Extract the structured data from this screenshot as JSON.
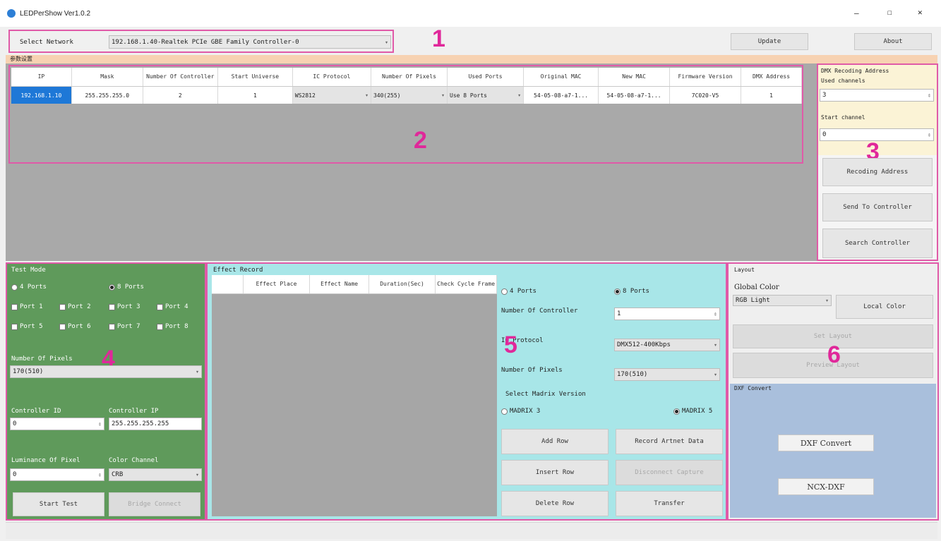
{
  "window": {
    "title": "LEDPerShow Ver1.0.2",
    "controls": {
      "minimize": "—",
      "maximize": "☐",
      "close": "✕"
    }
  },
  "annotations": [
    "1",
    "2",
    "3",
    "4",
    "5",
    "6"
  ],
  "network": {
    "label": "Select Network",
    "value": "192.168.1.40-Realtek PCIe GBE Family Controller-0",
    "update": "Update",
    "about": "About"
  },
  "section_title": "参数设置",
  "controller_table": {
    "headers": [
      "IP",
      "Mask",
      "Number Of Controller",
      "Start Universe",
      "IC Protocol",
      "Number Of Pixels",
      "Used Ports",
      "Original MAC",
      "New MAC",
      "Firmware Version",
      "DMX Address"
    ],
    "rows": [
      [
        "192.168.1.10",
        "255.255.255.0",
        "2",
        "1",
        "WS2812",
        "340(255)",
        "Use 8 Ports",
        "54-05-08-a7-1...",
        "54-05-08-a7-1...",
        "7C020-V5",
        "1"
      ]
    ]
  },
  "dmx_panel": {
    "title": "DMX Recoding Address",
    "used_channels_label": "Used channels",
    "used_channels_value": "3",
    "start_channel_label": "Start channel",
    "start_channel_value": "0",
    "recoding_button": "Recoding Address",
    "send_button": "Send To Controller",
    "search_button": "Search Controller"
  },
  "test_mode": {
    "title": "Test Mode",
    "ports4": "4 Ports",
    "ports8": "8 Ports",
    "port_checks": [
      "Port 1",
      "Port 2",
      "Port 3",
      "Port 4",
      "Port 5",
      "Port 6",
      "Port 7",
      "Port 8"
    ],
    "pixels_label": "Number Of Pixels",
    "pixels_value": "170(510)",
    "controller_id_label": "Controller ID",
    "controller_id_value": "0",
    "controller_ip_label": "Controller IP",
    "controller_ip_value": "255.255.255.255",
    "luminance_label": "Luminance Of Pixel",
    "luminance_value": "0",
    "color_channel_label": "Color Channel",
    "color_channel_value": "CRB",
    "start_test": "Start Test",
    "bridge_connect": "Bridge Connect"
  },
  "effect_record": {
    "title": "Effect Record",
    "headers": [
      "",
      "Effect Place",
      "Effect Name",
      "Duration(Sec)",
      "Check Cycle Frame"
    ],
    "ports4": "4 Ports",
    "ports8": "8 Ports",
    "controller_count_label": "Number Of Controller",
    "controller_count_value": "1",
    "ic_protocol_label": "IC Protocol",
    "ic_protocol_value": "DMX512-400Kbps",
    "pixels_label": "Number Of Pixels",
    "pixels_value": "170(510)",
    "madrix_label": "Select Madrix Version",
    "madrix3": "MADRIX 3",
    "madrix5": "MADRIX 5",
    "add_row": "Add Row",
    "record_artnet": "Record Artnet Data",
    "insert_row": "Insert Row",
    "disconnect_capture": "Disconnect Capture",
    "delete_row": "Delete Row",
    "transfer": "Transfer"
  },
  "layout_panel": {
    "title": "Layout",
    "global_color_label": "Global Color",
    "global_color_value": "RGB Light",
    "local_color": "Local Color",
    "disabled_btn1": "Set Layout",
    "disabled_btn2": "Preview Layout",
    "dxf_title": "DXF Convert",
    "dxf_convert": "DXF Convert",
    "ncx_dxf": "NCX-DXF"
  }
}
